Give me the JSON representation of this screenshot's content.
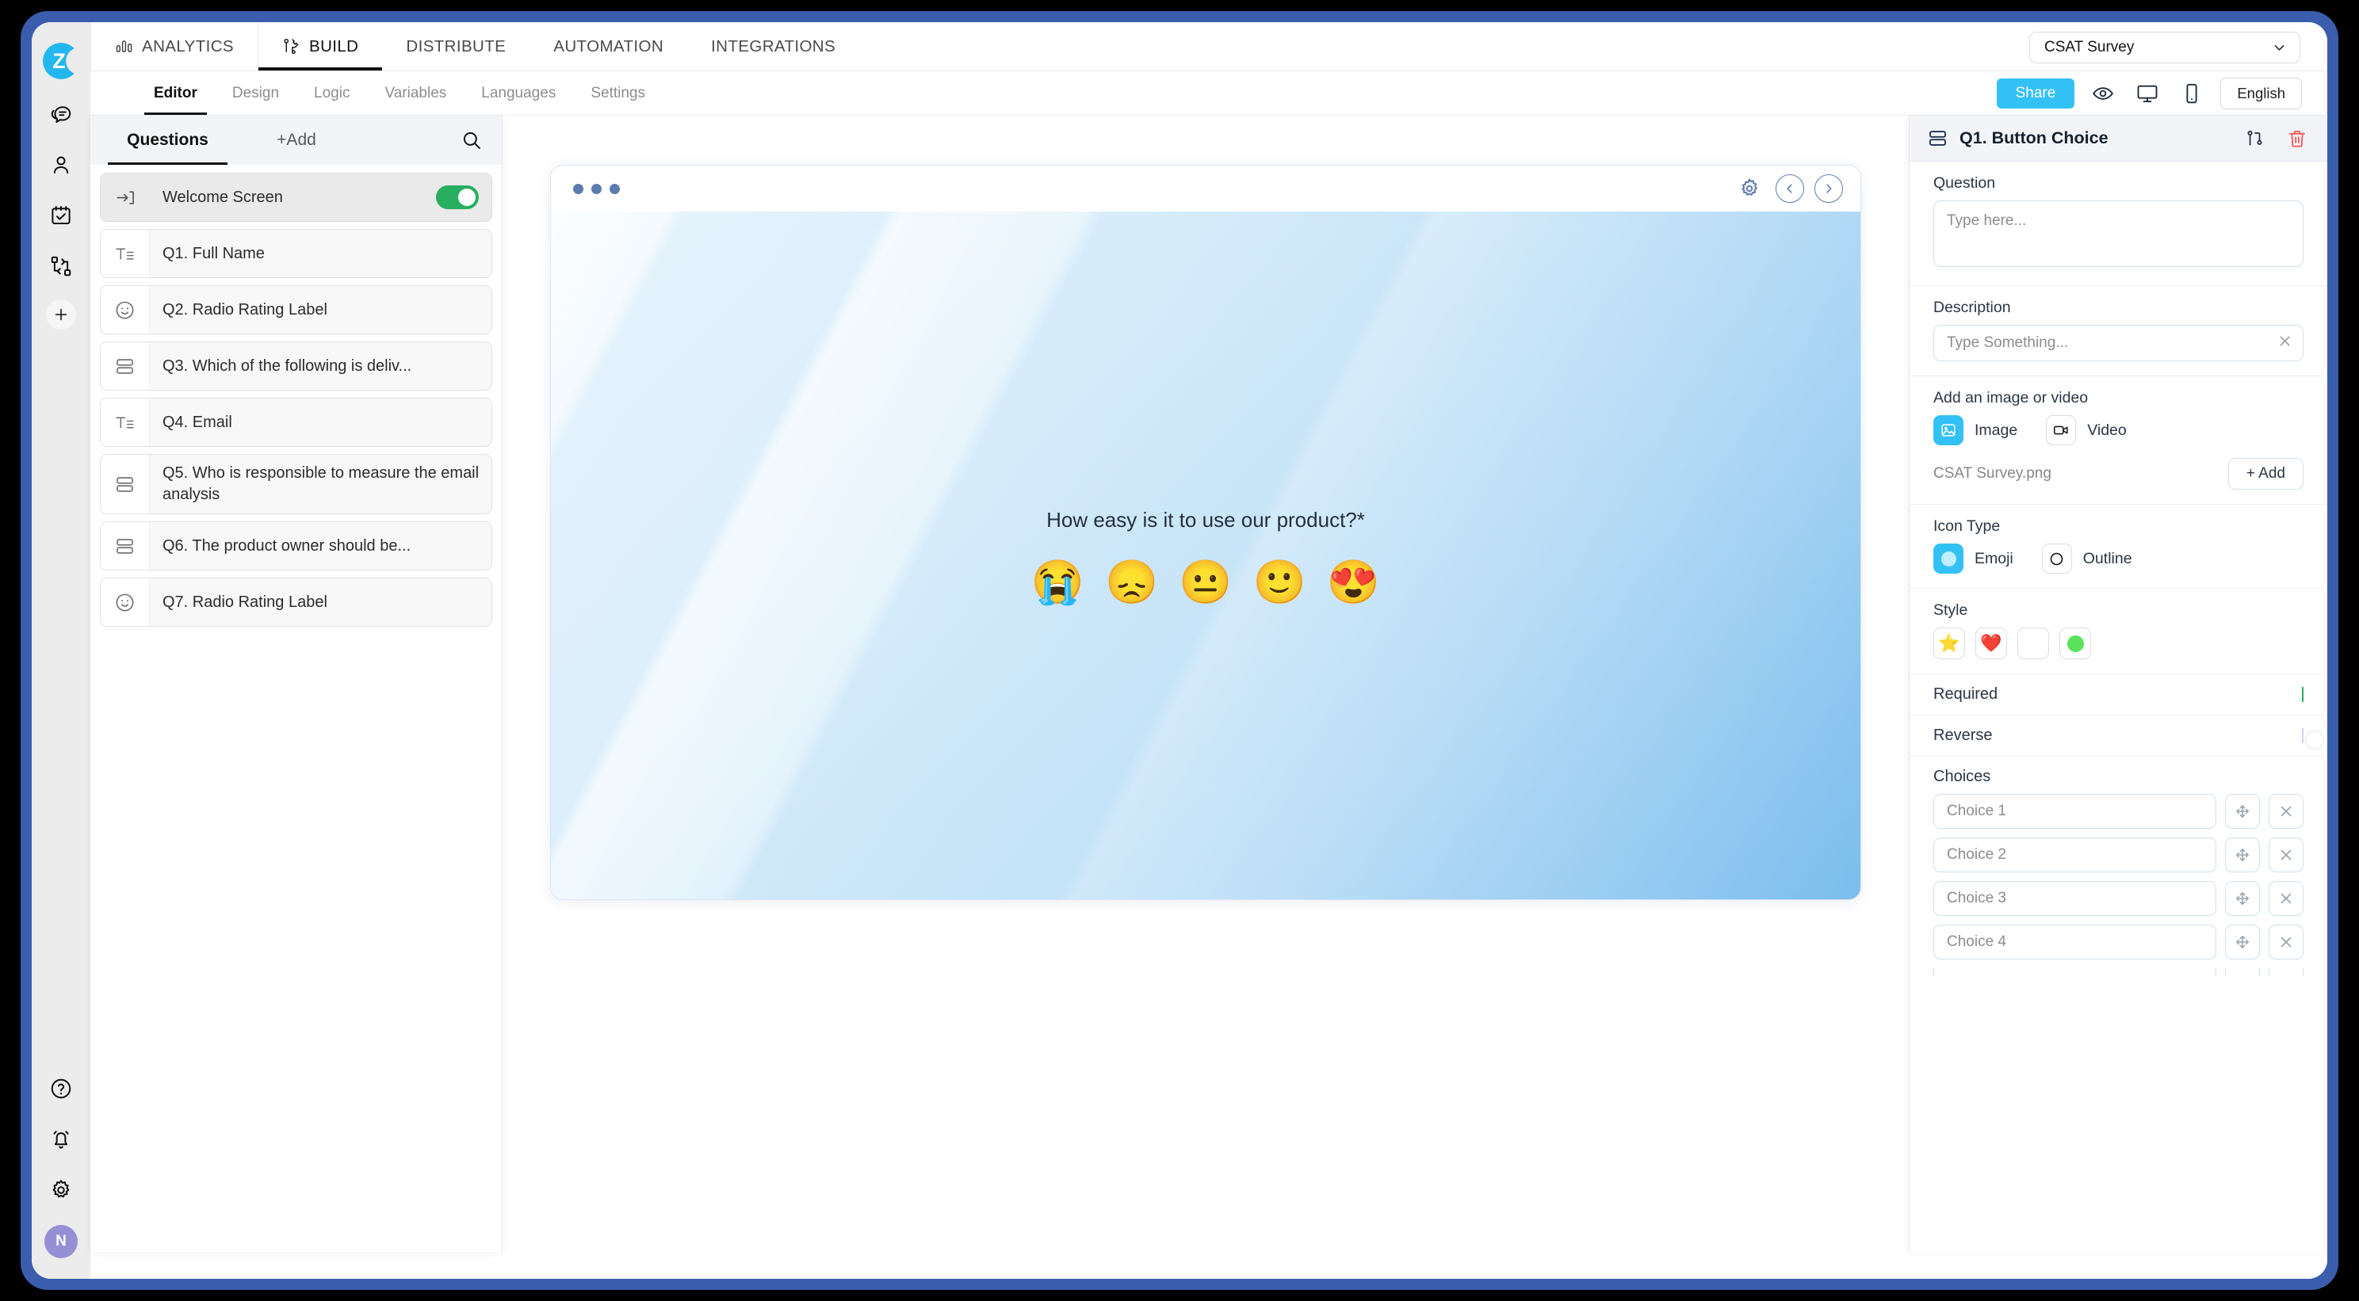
{
  "app": {
    "logo_letter": "Z",
    "user_initial": "N"
  },
  "rail": {
    "items": [
      {
        "name": "chat-icon",
        "label": "Chat"
      },
      {
        "name": "contacts-icon",
        "label": "Contacts"
      },
      {
        "name": "tasks-icon",
        "label": "Tasks"
      },
      {
        "name": "workflow-icon",
        "label": "Workflow"
      },
      {
        "name": "add-icon",
        "label": "Add"
      }
    ],
    "bottom_items": [
      {
        "name": "help-icon",
        "label": "Help"
      },
      {
        "name": "notifications-icon",
        "label": "Notifications"
      },
      {
        "name": "settings-icon",
        "label": "Settings"
      }
    ]
  },
  "topnav": {
    "items": [
      {
        "label": "ANALYTICS",
        "icon": "bar-chart-icon",
        "active": false
      },
      {
        "label": "BUILD",
        "icon": "tools-icon",
        "active": true
      },
      {
        "label": "DISTRIBUTE",
        "icon": "",
        "active": false
      },
      {
        "label": "AUTOMATION",
        "icon": "",
        "active": false
      },
      {
        "label": "INTEGRATIONS",
        "icon": "",
        "active": false
      }
    ],
    "survey_select": "CSAT Survey"
  },
  "subnav": {
    "items": [
      {
        "label": "Editor",
        "active": true
      },
      {
        "label": "Design",
        "active": false
      },
      {
        "label": "Logic",
        "active": false
      },
      {
        "label": "Variables",
        "active": false
      },
      {
        "label": "Languages",
        "active": false
      },
      {
        "label": "Settings",
        "active": false
      }
    ],
    "share_label": "Share",
    "language_label": "English"
  },
  "questions_panel": {
    "tab_questions": "Questions",
    "tab_add": "+Add",
    "items": [
      {
        "label": "Welcome Screen",
        "icon": "welcome-screen-icon",
        "type": "welcome",
        "toggle": true
      },
      {
        "label": "Q1. Full Name",
        "icon": "text-field-icon",
        "type": "text"
      },
      {
        "label": "Q2. Radio Rating Label",
        "icon": "smiley-icon",
        "type": "rating"
      },
      {
        "label": "Q3. Which of the following is deliv...",
        "icon": "choice-icon",
        "type": "choice"
      },
      {
        "label": "Q4. Email",
        "icon": "text-field-icon",
        "type": "text"
      },
      {
        "label": "Q5. Who is responsible to measure the email analysis",
        "icon": "choice-icon",
        "type": "choice"
      },
      {
        "label": "Q6. The product owner should be...",
        "icon": "choice-icon",
        "type": "choice"
      },
      {
        "label": "Q7. Radio Rating Label",
        "icon": "smiley-icon",
        "type": "rating"
      }
    ]
  },
  "preview": {
    "question_text": "How easy is it to use our product?*",
    "emojis": [
      "😭",
      "😞",
      "😐",
      "🙂",
      "😍"
    ],
    "bg_from": "#eaf5fd",
    "bg_to": "#8fc8ef"
  },
  "properties": {
    "title": "Q1. Button Choice",
    "question_label": "Question",
    "question_value": "",
    "question_placeholder": "Type here...",
    "description_label": "Description",
    "description_value": "",
    "description_placeholder": "Type Something...",
    "media_label": "Add an image or video",
    "media_image_label": "Image",
    "media_video_label": "Video",
    "media_selected": "Image",
    "file_name": "CSAT Survey.png",
    "add_button_label": "+ Add",
    "icon_type_label": "Icon Type",
    "icon_type_emoji_label": "Emoji",
    "icon_type_outline_label": "Outline",
    "icon_type_selected": "Emoji",
    "style_label": "Style",
    "style_options": [
      "⭐",
      "❤️",
      "",
      "●"
    ],
    "style_selected_index": 0,
    "required_label": "Required",
    "required_on": true,
    "reverse_label": "Reverse",
    "reverse_on": false,
    "choices_label": "Choices",
    "choices": [
      {
        "value": "",
        "placeholder": "Choice 1"
      },
      {
        "value": "",
        "placeholder": "Choice 2"
      },
      {
        "value": "",
        "placeholder": "Choice 3"
      },
      {
        "value": "",
        "placeholder": "Choice 4"
      }
    ]
  },
  "colors": {
    "brand_blue": "#33c1f5",
    "frame_blue": "#3b5dae",
    "toggle_green": "#27ae60",
    "delete_red": "#f15b5b",
    "avatar_purple": "#9590d6"
  }
}
